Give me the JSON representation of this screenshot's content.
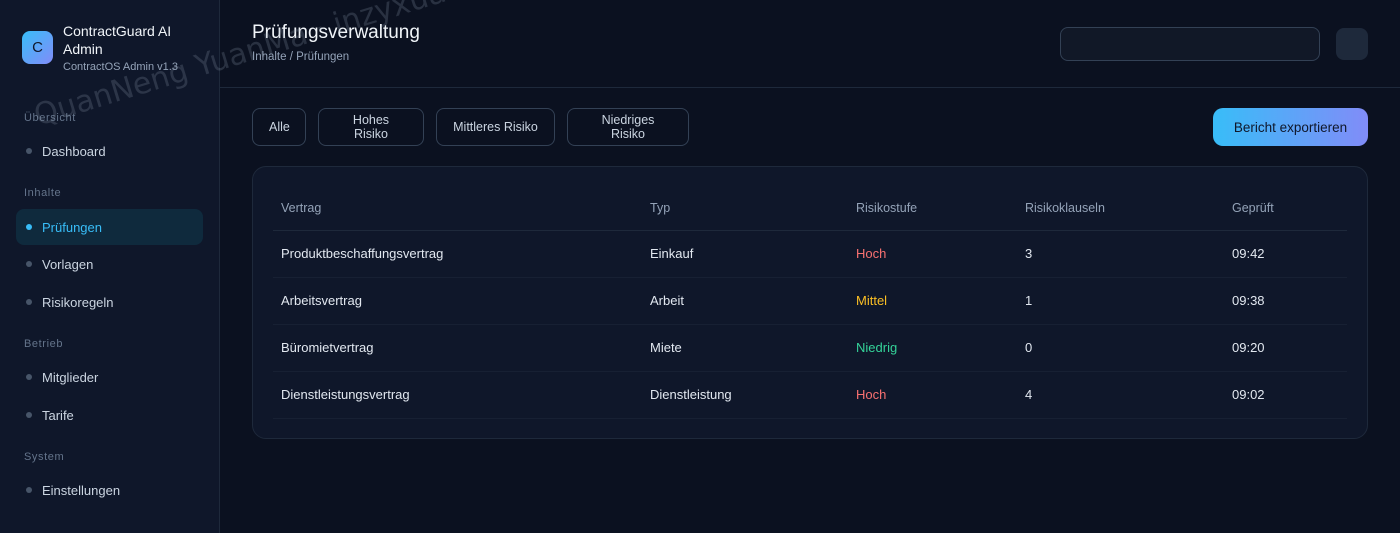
{
  "brand": {
    "logo_letter": "C",
    "name": "ContractGuard AI Admin",
    "subtitle": "ContractOS Admin v1.3"
  },
  "sidebar": {
    "sections": [
      "Übersicht",
      "Inhalte",
      "Betrieb",
      "System"
    ],
    "items": [
      {
        "label": "Dashboard",
        "active": false
      },
      {
        "label": "Prüfungen",
        "active": true
      },
      {
        "label": "Vorlagen",
        "active": false
      },
      {
        "label": "Risikoregeln",
        "active": false
      },
      {
        "label": "Mitglieder",
        "active": false
      },
      {
        "label": "Tarife",
        "active": false
      },
      {
        "label": "Einstellungen",
        "active": false
      }
    ]
  },
  "header": {
    "title": "Prüfungsverwaltung",
    "breadcrumb": "Inhalte / Prüfungen",
    "search_value": ""
  },
  "filters": [
    "Alle",
    "Hohes Risiko",
    "Mittleres Risiko",
    "Niedriges Risiko"
  ],
  "export_label": "Bericht exportieren",
  "table": {
    "columns": [
      "Vertrag",
      "Typ",
      "Risikostufe",
      "Risikoklauseln",
      "Geprüft"
    ],
    "rows": [
      [
        "Produktbeschaffungsvertrag",
        "Einkauf",
        "Hoch",
        "3",
        "09:42"
      ],
      [
        "Arbeitsvertrag",
        "Arbeit",
        "Mittel",
        "1",
        "09:38"
      ],
      [
        "Büromietvertrag",
        "Miete",
        "Niedrig",
        "0",
        "09:20"
      ],
      [
        "Dienstleistungsvertrag",
        "Dienstleistung",
        "Hoch",
        "4",
        "09:02"
      ]
    ]
  },
  "colors": {
    "accent": "#38bdf8",
    "accent_2": "#818cf8",
    "risk_high": "#f87171",
    "risk_medium": "#fbbf24",
    "risk_low": "#34d399"
  },
  "watermark": "QuanNeng YuanMa · inzyxuashop.com"
}
